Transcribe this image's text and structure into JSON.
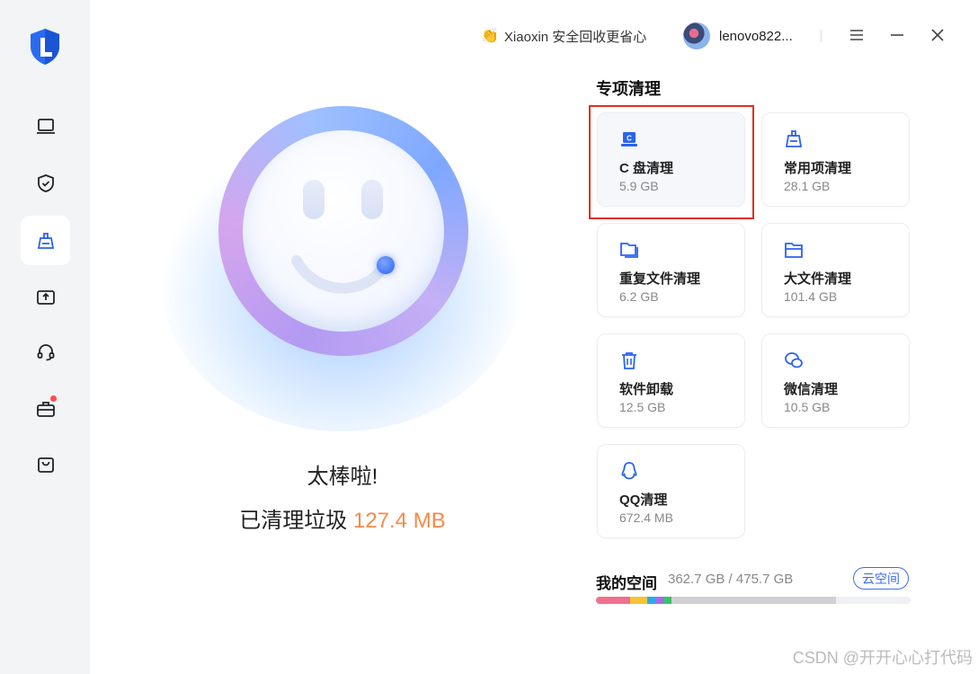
{
  "promo": {
    "icon": "clap-hands-icon",
    "text": "Xiaoxin 安全回收更省心"
  },
  "user": {
    "name": "lenovo822..."
  },
  "sidebar": {
    "items": [
      {
        "icon": "laptop-icon"
      },
      {
        "icon": "shield-check-icon"
      },
      {
        "icon": "cleaner-icon",
        "active": true
      },
      {
        "icon": "drive-upload-icon"
      },
      {
        "icon": "headset-icon"
      },
      {
        "icon": "toolbox-icon",
        "badge": true
      },
      {
        "icon": "shopping-bag-icon"
      }
    ]
  },
  "result": {
    "headline": "太棒啦!",
    "cleaned_label": "已清理垃圾",
    "cleaned_amount": "127.4 MB"
  },
  "special_clean": {
    "title": "专项清理",
    "cards": [
      {
        "icon": "c-drive-icon",
        "name": "C 盘清理",
        "size": "5.9 GB",
        "selected": true
      },
      {
        "icon": "broom-icon",
        "name": "常用项清理",
        "size": "28.1 GB"
      },
      {
        "icon": "duplicate-files-icon",
        "name": "重复文件清理",
        "size": "6.2 GB"
      },
      {
        "icon": "folder-icon",
        "name": "大文件清理",
        "size": "101.4 GB"
      },
      {
        "icon": "trash-icon",
        "name": "软件卸载",
        "size": "12.5 GB"
      },
      {
        "icon": "wechat-icon",
        "name": "微信清理",
        "size": "10.5 GB"
      },
      {
        "icon": "qq-icon",
        "name": "QQ清理",
        "size": "672.4 MB"
      }
    ]
  },
  "space": {
    "title": "我的空间",
    "value": "362.7 GB / 475.7 GB",
    "cloud_button": "云空间",
    "segments": [
      {
        "color": "#f0708e",
        "fraction": 0.108
      },
      {
        "color": "#f6c433",
        "fraction": 0.054
      },
      {
        "color": "#2fa8e8",
        "fraction": 0.026
      },
      {
        "color": "#a06ee8",
        "fraction": 0.026
      },
      {
        "color": "#3dbf6a",
        "fraction": 0.026
      },
      {
        "color": "#cfcfd4",
        "fraction": 0.522
      }
    ]
  },
  "watermark": "CSDN @开开心心打代码",
  "colors": {
    "accent": "#3c6df0",
    "amount": "#f28c4b",
    "highlight": "#e0301e"
  }
}
